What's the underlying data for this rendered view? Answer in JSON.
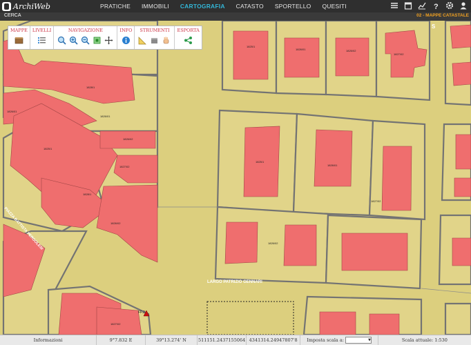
{
  "app": {
    "name": "ArchiWeb"
  },
  "nav": {
    "items": [
      "PRATICHE",
      "IMMOBILI",
      "CARTOGRAFIA",
      "CATASTO",
      "SPORTELLO",
      "QUESITI"
    ],
    "active": "CARTOGRAFIA"
  },
  "top_icons": [
    "list-icon",
    "calendar-icon",
    "chart-icon",
    "help-icon",
    "gear-icon",
    "user-icon"
  ],
  "subbar": {
    "search_label": "CERCA",
    "layer_label": "02 - MAPPE CATASTALE"
  },
  "toolbox": {
    "mappe": "MAPPE",
    "livelli": "LIVELLI",
    "navigazione": "NAVIGAZIONE",
    "info": "INFO",
    "strumenti": "STRUMENTI",
    "esporta": "ESPORTA"
  },
  "map": {
    "street_labels": [
      "LARGO PATRIZIO GENNARI",
      "PIAZZA BATTISTA PERGOLESI"
    ],
    "parcel_ids": [
      "1825/1",
      "1826/01",
      "1826/02",
      "1827/02",
      "1828/1"
    ],
    "marker_label": "FF.2",
    "corner_label": "S"
  },
  "status": {
    "info_label": "Informazioni",
    "lon": "9°7.832 E",
    "lat": "39°13.274' N",
    "x": "511151.2437155064",
    "y": "4341314.24947807'8",
    "scale_label": "Imposta scala a:",
    "scale_current": "Scala attuale: 1:530"
  },
  "colors": {
    "lot": "#dccf7e",
    "building": "#ef6e6e",
    "outline": "#6f6f6f",
    "accent": "#33b5d6"
  }
}
